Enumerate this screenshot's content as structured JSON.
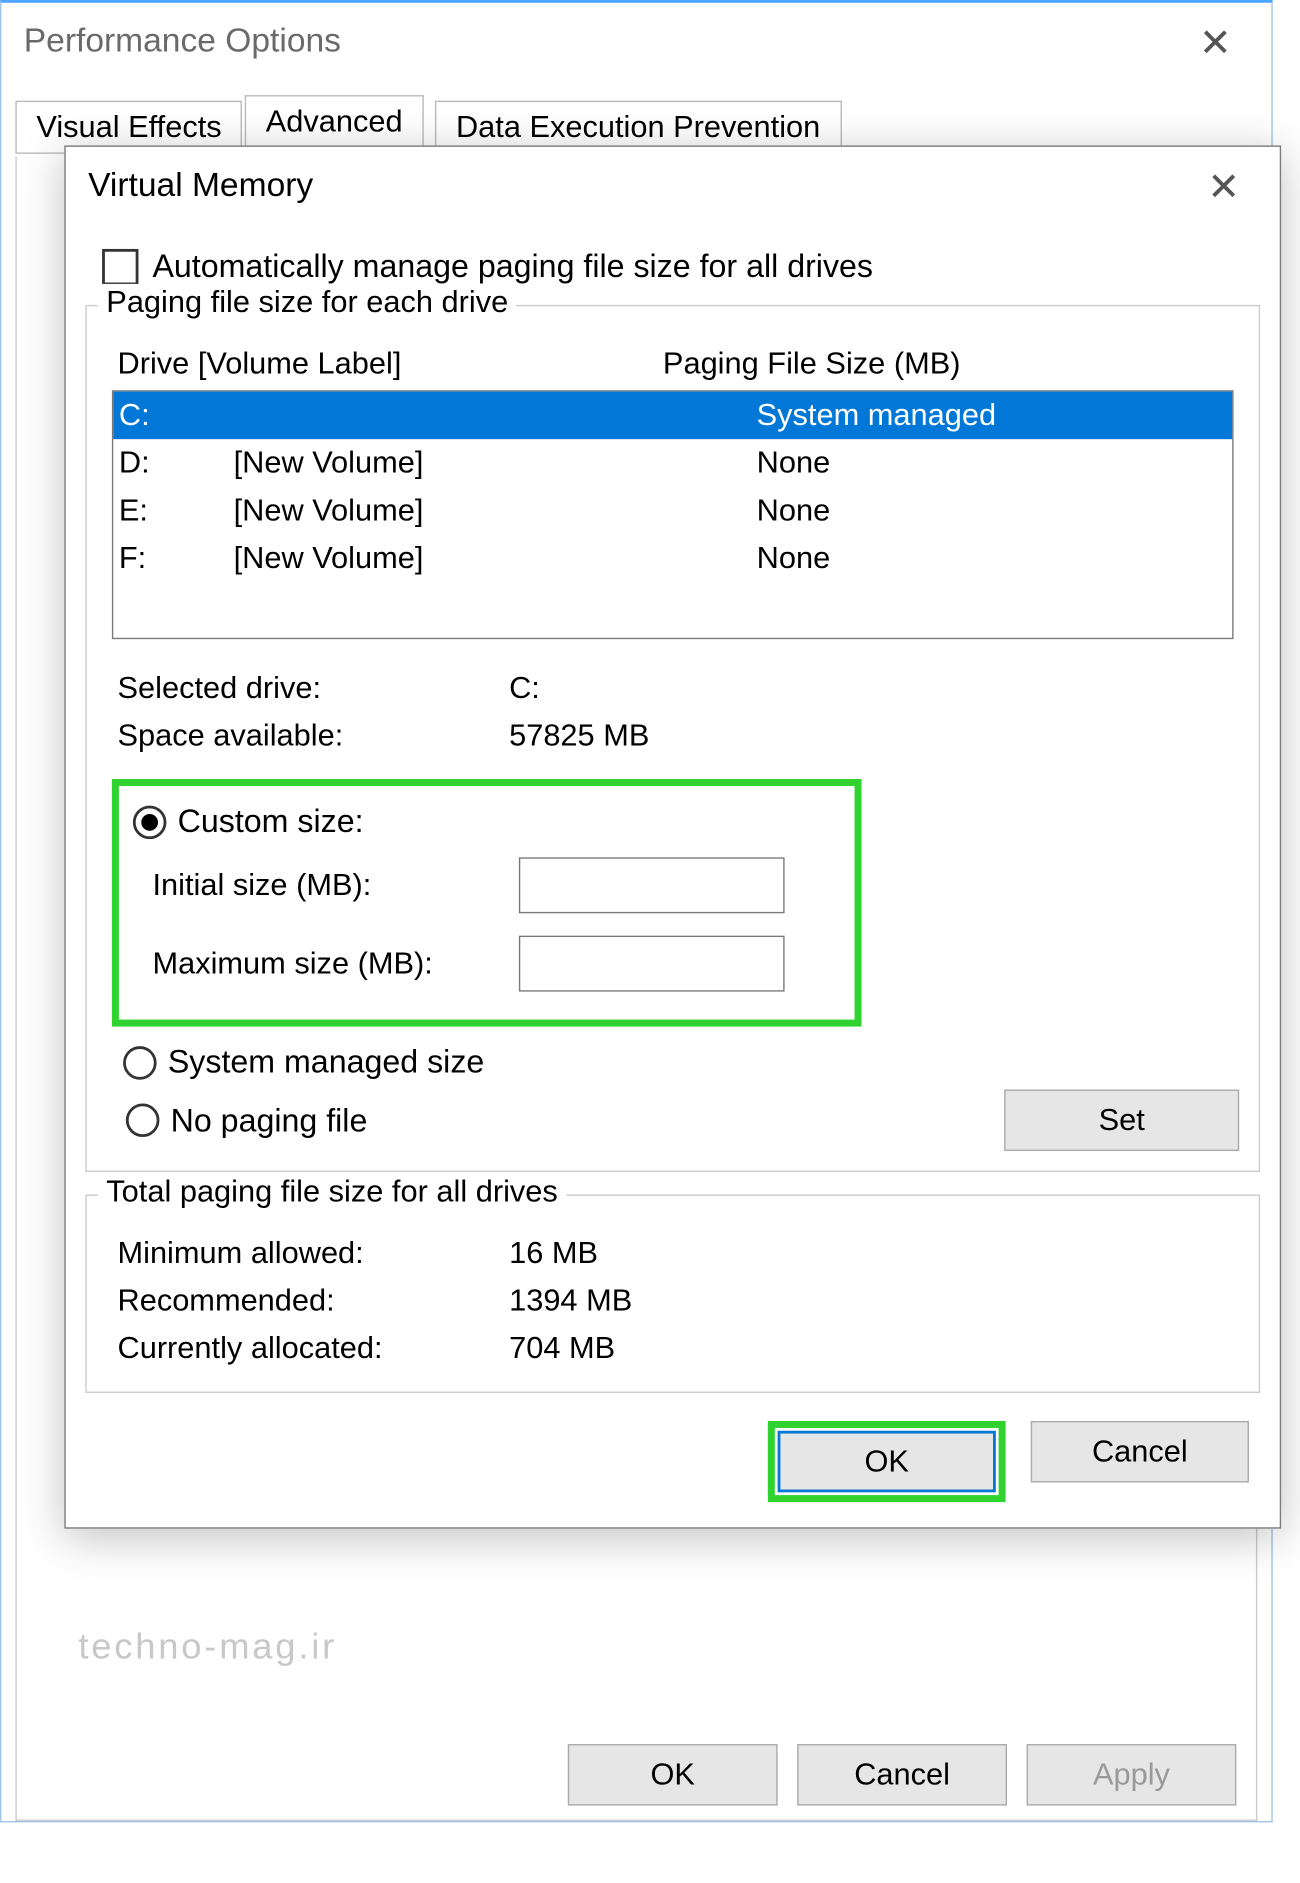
{
  "back_dialog": {
    "title": "Performance Options",
    "tabs": [
      "Visual Effects",
      "Advanced",
      "Data Execution Prevention"
    ],
    "buttons": {
      "ok": "OK",
      "cancel": "Cancel",
      "apply": "Apply"
    }
  },
  "watermark": "techno-mag.ir",
  "vm": {
    "title": "Virtual Memory",
    "auto_checkbox_label": "Automatically manage paging file size for all drives",
    "group1_title": "Paging file size for each drive",
    "col_drive": "Drive  [Volume Label]",
    "col_pfs": "Paging File Size (MB)",
    "drives": [
      {
        "letter": "C:",
        "label": "",
        "pfs": "System managed",
        "selected": true
      },
      {
        "letter": "D:",
        "label": "[New Volume]",
        "pfs": "None",
        "selected": false
      },
      {
        "letter": "E:",
        "label": "[New Volume]",
        "pfs": "None",
        "selected": false
      },
      {
        "letter": "F:",
        "label": "[New Volume]",
        "pfs": "None",
        "selected": false
      }
    ],
    "selected_drive_label": "Selected drive:",
    "selected_drive_value": "C:",
    "space_label": "Space available:",
    "space_value": "57825 MB",
    "custom_size_label": "Custom size:",
    "initial_label": "Initial size (MB):",
    "initial_value": "",
    "max_label": "Maximum size (MB):",
    "max_value": "",
    "system_managed_label": "System managed size",
    "no_paging_label": "No paging file",
    "set_button": "Set",
    "group2_title": "Total paging file size for all drives",
    "min_allowed_label": "Minimum allowed:",
    "min_allowed_value": "16 MB",
    "recommended_label": "Recommended:",
    "recommended_value": "1394 MB",
    "current_label": "Currently allocated:",
    "current_value": "704 MB",
    "ok": "OK",
    "cancel": "Cancel"
  }
}
